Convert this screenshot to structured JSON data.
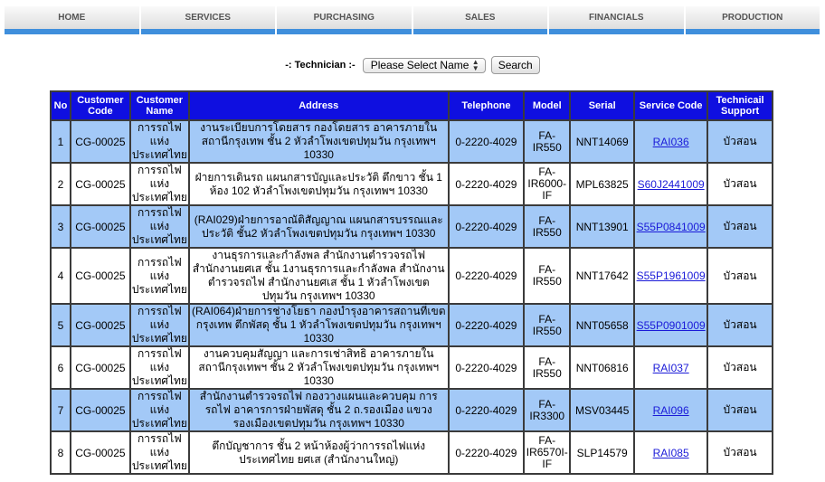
{
  "nav": [
    "HOME",
    "SERVICES",
    "PURCHASING",
    "SALES",
    "FINANCIALS",
    "PRODUCTION"
  ],
  "filter": {
    "label": "-: Technician :-",
    "select_value": "Please Select Name",
    "search_label": "Search"
  },
  "table": {
    "headers": [
      "No",
      "Customer Code",
      "Customer Name",
      "Address",
      "Telephone",
      "Model",
      "Serial",
      "Service Code",
      "Technicail Support"
    ],
    "rows": [
      {
        "no": "1",
        "code": "CG-00025",
        "name": "การรถไฟแห่งประเทศไทย",
        "address": "งานระเบียบการโดยสาร กองโดยสาร อาคารภายในสถานีกรุงเทพ ชั้น 2 หัวลำโพงเขตปทุมวัน กรุงเทพฯ 10330",
        "tel": "0-2220-4029",
        "model": "FA-IR550",
        "serial": "NNT14069",
        "service": "RAI036",
        "support": "บัวสอน"
      },
      {
        "no": "2",
        "code": "CG-00025",
        "name": "การรถไฟแห่งประเทศไทย",
        "address": "ฝ่ายการเดินรถ แผนกสารบัญและประวัติ ตึกขาว ชั้น 1 ห้อง 102 หัวลำโพงเขตปทุมวัน กรุงเทพฯ 10330",
        "tel": "0-2220-4029",
        "model": "FA-IR6000-IF",
        "serial": "MPL63825",
        "service": "S60J2441009",
        "support": "บัวสอน"
      },
      {
        "no": "3",
        "code": "CG-00025",
        "name": "การรถไฟแห่งประเทศไทย",
        "address": "(RAI029)ฝ่ายการอาณัติสัญญาณ แผนกสารบรรณและประวัติ ชั้น2 หัวลำโพงเขตปทุมวัน กรุงเทพฯ 10330",
        "tel": "0-2220-4029",
        "model": "FA-IR550",
        "serial": "NNT13901",
        "service": "S55P0841009",
        "support": "บัวสอน"
      },
      {
        "no": "4",
        "code": "CG-00025",
        "name": "การรถไฟแห่งประเทศไทย",
        "address": "งานธุรการและกำลังพล สำนักงานตำรวจรถไฟ สำนักงานยศเส ชั้น 1งานธุรการและกำลังพล สำนักงานตำรวจรถไฟ สำนักงานยศเส ชั้น 1 หัวลำโพงเขตปทุมวัน กรุงเทพฯ 10330",
        "tel": "0-2220-4029",
        "model": "FA-IR550",
        "serial": "NNT17642",
        "service": "S55P1961009",
        "support": "บัวสอน"
      },
      {
        "no": "5",
        "code": "CG-00025",
        "name": "การรถไฟแห่งประเทศไทย",
        "address": "(RAI064)ฝ่ายการช่างโยธา กองบำรุงอาคารสถานที่เขตกรุงเทพ ตึกพัสดุ ชั้น 1 หัวลำโพงเขตปทุมวัน กรุงเทพฯ 10330",
        "tel": "0-2220-4029",
        "model": "FA-IR550",
        "serial": "NNT05658",
        "service": "S55P0901009",
        "support": "บัวสอน"
      },
      {
        "no": "6",
        "code": "CG-00025",
        "name": "การรถไฟแห่งประเทศไทย",
        "address": "งานควบคุมสัญญา และการเช่าสิทธิ อาคารภายในสถานีกรุงเทพฯ ชั้น 2 หัวลำโพงเขตปทุมวัน กรุงเทพฯ 10330",
        "tel": "0-2220-4029",
        "model": "FA-IR550",
        "serial": "NNT06816",
        "service": "RAI037",
        "support": "บัวสอน"
      },
      {
        "no": "7",
        "code": "CG-00025",
        "name": "การรถไฟแห่งประเทศไทย",
        "address": "สำนักงานตำรวจรถไฟ กองวางแผนและควบคุม การรถไฟ อาคารการฝ่ายพัสดุ ชั้น 2 ถ.รองเมือง แขวงรองเมืองเขตปทุมวัน กรุงเทพฯ 10330",
        "tel": "0-2220-4029",
        "model": "FA-IR3300",
        "serial": "MSV03445",
        "service": "RAI096",
        "support": "บัวสอน"
      },
      {
        "no": "8",
        "code": "CG-00025",
        "name": "การรถไฟแห่งประเทศไทย",
        "address": "ตึกบัญชาการ ชั้น 2 หน้าห้องผู้ว่าการรถไฟแห่งประเทศไทย ยศเส (สำนักงานใหญ่)",
        "tel": "0-2220-4029",
        "model": "FA-IR6570I-IF",
        "serial": "SLP14579",
        "service": "RAI085",
        "support": "บัวสอน"
      }
    ]
  }
}
